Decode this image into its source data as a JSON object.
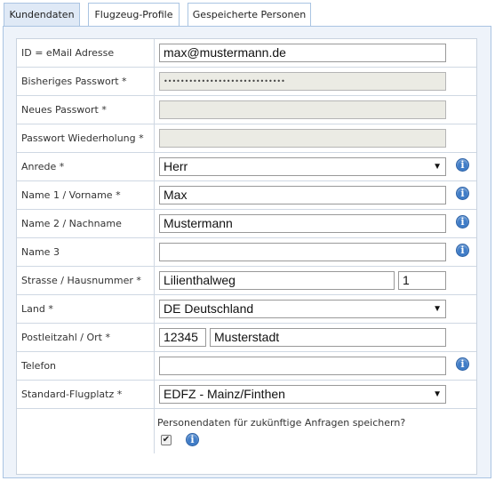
{
  "tabs": [
    {
      "label": "Kundendaten",
      "active": true
    },
    {
      "label": "Flugzeug-Profile",
      "active": false
    },
    {
      "label": "Gespeicherte Personen",
      "active": false
    }
  ],
  "form": {
    "email": {
      "label": "ID = eMail Adresse",
      "value": "max@mustermann.de"
    },
    "old_password": {
      "label": "Bisheriges Passwort *",
      "value": "•••••••••••••••••••••••••••••"
    },
    "new_password": {
      "label": "Neues Passwort *",
      "value": ""
    },
    "password_repeat": {
      "label": "Passwort Wiederholung *",
      "value": ""
    },
    "salutation": {
      "label": "Anrede *",
      "value": "Herr"
    },
    "name1": {
      "label": "Name 1 / Vorname *",
      "value": "Max"
    },
    "name2": {
      "label": "Name 2 / Nachname",
      "value": "Mustermann"
    },
    "name3": {
      "label": "Name 3",
      "value": ""
    },
    "street": {
      "label": "Strasse / Hausnummer *",
      "street_value": "Lilienthalweg",
      "number_value": "1"
    },
    "country": {
      "label": "Land *",
      "value": "DE Deutschland"
    },
    "postal": {
      "label": "Postleitzahl / Ort *",
      "zip_value": "12345",
      "city_value": "Musterstadt"
    },
    "phone": {
      "label": "Telefon",
      "value": ""
    },
    "airfield": {
      "label": "Standard-Flugplatz *",
      "value": "EDFZ - Mainz/Finthen"
    },
    "save_persons": {
      "text": "Personendaten für zukünftige Anfragen speichern?",
      "checked": true
    }
  },
  "icons": {
    "info": "info-icon",
    "dropdown": "chevron-down-icon",
    "check": "checkmark-icon"
  },
  "colors": {
    "tab_border": "#aac4e2",
    "active_tab": "#dfe9f6",
    "info_icon": "#3f7cc7",
    "disabled_field": "#ebebe4"
  }
}
